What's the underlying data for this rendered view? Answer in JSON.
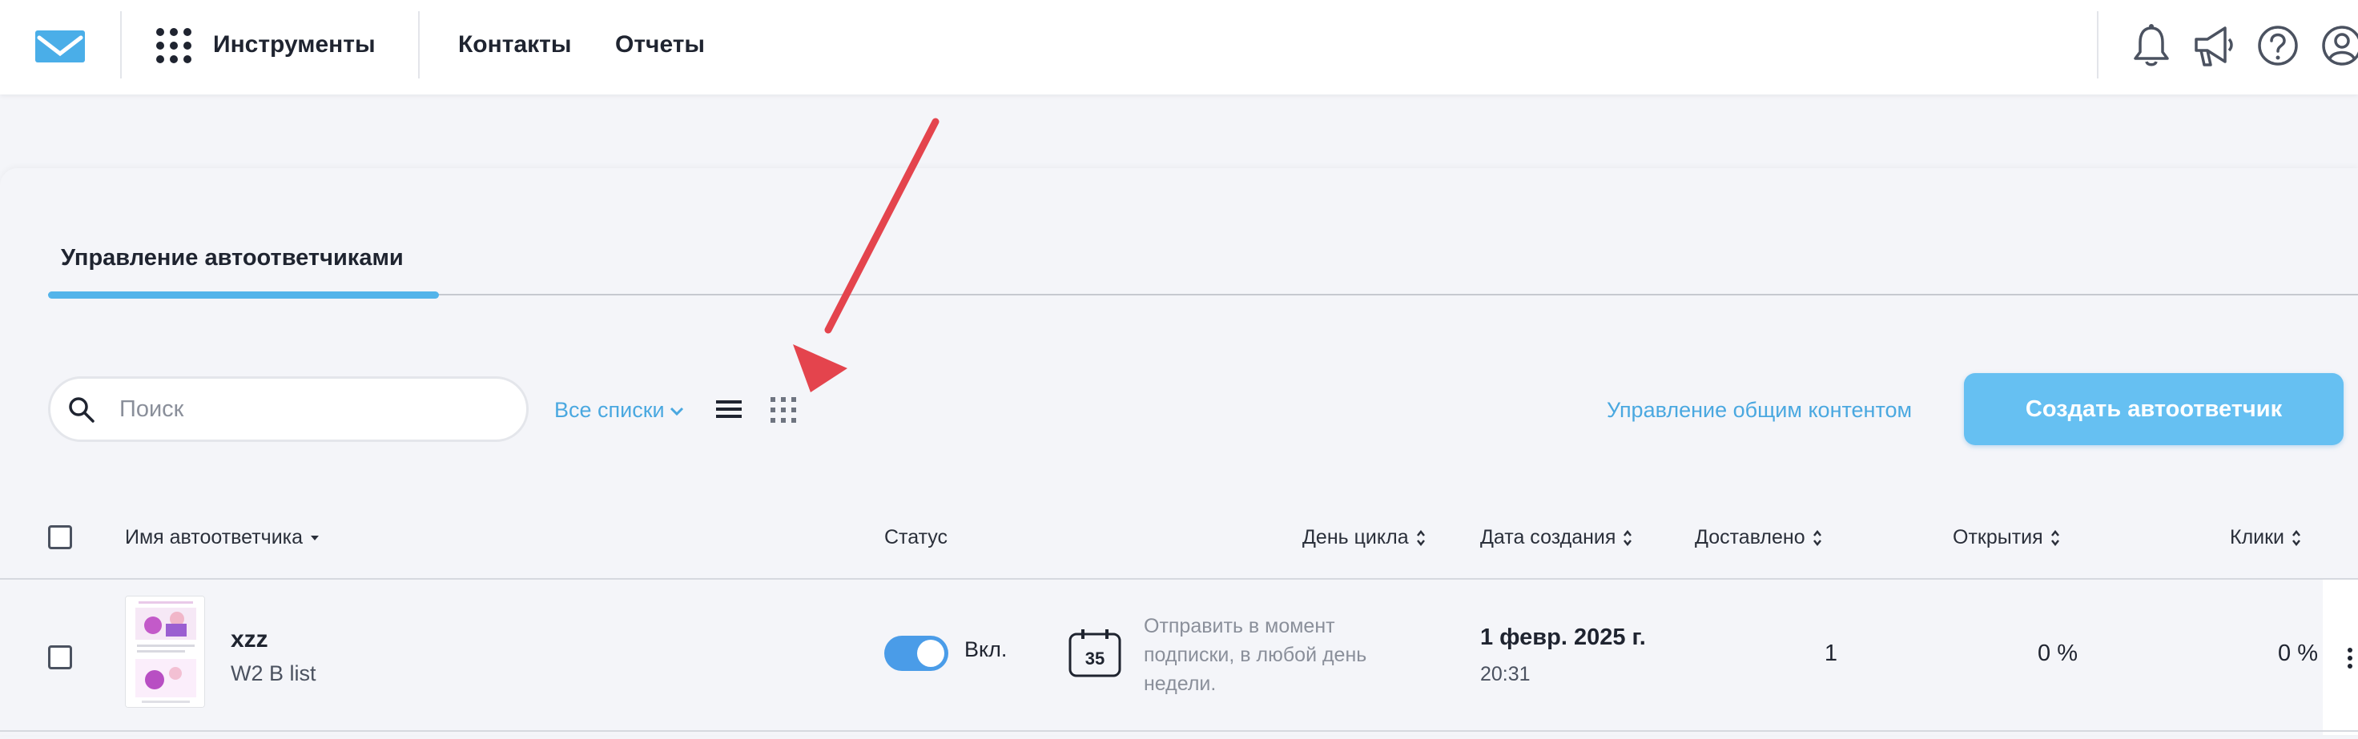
{
  "header": {
    "tools_label": "Инструменты",
    "nav": [
      "Контакты",
      "Отчеты"
    ]
  },
  "tabs": [
    {
      "label": "Управление автоответчиками",
      "active": true
    }
  ],
  "toolbar": {
    "search_placeholder": "Поиск",
    "search_value": "",
    "lists_filter": "Все списки",
    "shared_content_link": "Управление общим контентом",
    "create_button": "Создать автоответчик"
  },
  "table": {
    "columns": [
      "Имя автоответчика",
      "Статус",
      "День цикла",
      "Дата создания",
      "Доставлено",
      "Открытия",
      "Клики"
    ],
    "rows": [
      {
        "name": "xzz",
        "list": "W2 B list",
        "status_label": "Вкл.",
        "enabled": true,
        "cycle_day": "35",
        "cycle_desc": "Отправить в момент подписки, в любой день недели.",
        "created_date": "1 февр. 2025 г.",
        "created_time": "20:31",
        "delivered": "1",
        "opens": "0 %",
        "clicks": "0 %"
      }
    ]
  },
  "colors": {
    "accent": "#4aa8e0",
    "button": "#66c0f2",
    "toggle_on": "#4a9ce8",
    "annotation_arrow": "#e4444d"
  },
  "icons": {
    "logo": "envelope-logo",
    "apps": "apps-grid-icon",
    "notifications": "bell-icon",
    "announcements": "megaphone-icon",
    "help": "help-icon",
    "account": "user-icon"
  }
}
